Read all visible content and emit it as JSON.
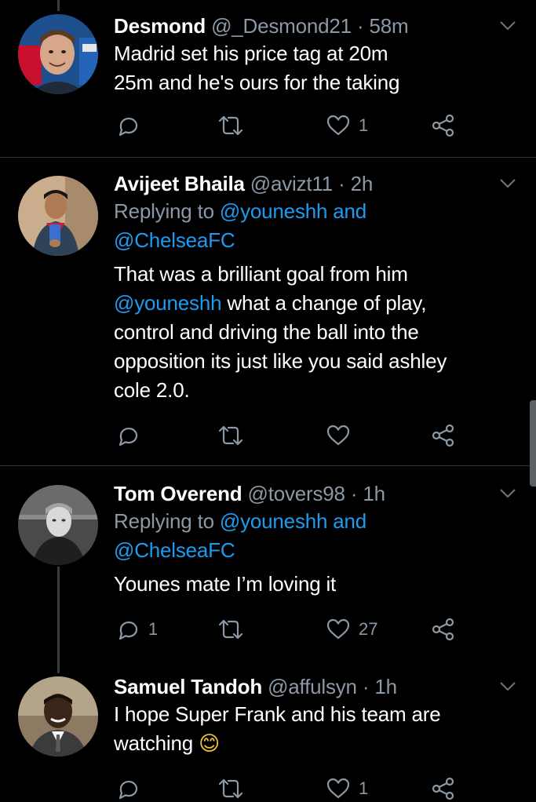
{
  "tweets": [
    {
      "name": "Desmond",
      "handle": "@_Desmond21",
      "separator": "·",
      "time": "58m",
      "reply_prefix": "",
      "reply_handle_1": "",
      "reply_and": "",
      "reply_handle_2": "",
      "lines": [
        "Madrid set his price tag at 20m",
        "25m and he's ours for the taking"
      ],
      "reply_count": "",
      "retweet_count": "",
      "like_count": "1"
    },
    {
      "name": "Avijeet Bhaila",
      "handle": "@avizt11",
      "separator": "·",
      "time": "2h",
      "reply_prefix": "Replying to ",
      "reply_handle_1": "@youneshh and",
      "reply_and": "",
      "reply_handle_2": "@ChelseaFC",
      "text_line1": "That was a brilliant goal from him",
      "text_mention": "@youneshh",
      "text_line2_rest": " what a change of play,",
      "text_line3": "control and driving the ball into the",
      "text_line4": "opposition its just like you said ashley",
      "text_line5": "cole 2.0.",
      "reply_count": "",
      "retweet_count": "",
      "like_count": ""
    },
    {
      "name": "Tom Overend",
      "handle": "@tovers98",
      "separator": "·",
      "time": "1h",
      "reply_prefix": "Replying to ",
      "reply_handle_1": "@youneshh and",
      "reply_handle_2": "@ChelseaFC",
      "lines": [
        "Younes mate I’m loving it"
      ],
      "reply_count": "1",
      "retweet_count": "",
      "like_count": "27"
    },
    {
      "name": "Samuel Tandoh",
      "handle": "@affulsyn",
      "separator": "·",
      "time": "1h",
      "lines": [
        "I hope Super Frank and his team are",
        "watching"
      ],
      "emoji": "😊",
      "reply_count": "",
      "retweet_count": "",
      "like_count": "1"
    }
  ],
  "icons": {
    "reply": "reply-icon",
    "retweet": "retweet-icon",
    "like": "heart-icon",
    "share": "share-icon",
    "more": "chevron-down-icon"
  },
  "colors": {
    "background": "#000000",
    "text": "#ffffff",
    "secondary": "#8b98a5",
    "accent": "#1d9bf0",
    "divider": "#2f3336"
  }
}
